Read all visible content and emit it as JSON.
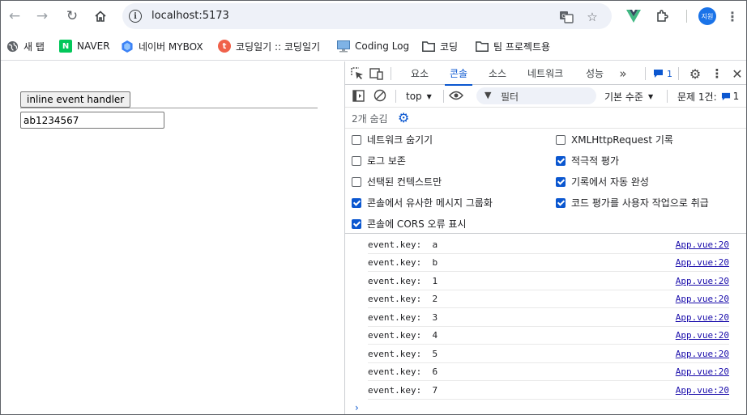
{
  "browser": {
    "url": "localhost:5173",
    "avatar_label": "지원",
    "bookmarks": [
      {
        "label": "새 탭",
        "icon": "globe-icon"
      },
      {
        "label": "NAVER",
        "icon": "naver-icon",
        "icon_text": "N"
      },
      {
        "label": "네이버 MYBOX",
        "icon": "mybox-icon"
      },
      {
        "label": "코딩일기 :: 코딩일기",
        "icon": "blog-icon"
      },
      {
        "label": "Coding Log",
        "icon": "monitor-icon"
      },
      {
        "label": "코딩",
        "icon": "folder-icon"
      },
      {
        "label": "팀 프로젝트용",
        "icon": "folder-icon"
      }
    ]
  },
  "page": {
    "button_label": "inline event handler",
    "input_value": "ab1234567"
  },
  "devtools": {
    "tabs": [
      "요소",
      "콘솔",
      "소스",
      "네트워크",
      "성능"
    ],
    "active_tab": "콘솔",
    "issues_badge": "1",
    "context": "top",
    "filter_placeholder": "필터",
    "level": "기본 수준",
    "issues_label": "문제 1건:",
    "issues_count": "1",
    "hidden_label": "2개 숨김",
    "settings": [
      {
        "label": "네트워크 숨기기",
        "checked": false
      },
      {
        "label": "XMLHttpRequest 기록",
        "checked": false
      },
      {
        "label": "로그 보존",
        "checked": false
      },
      {
        "label": "적극적 평가",
        "checked": true
      },
      {
        "label": "선택된 컨텍스트만",
        "checked": false
      },
      {
        "label": "기록에서 자동 완성",
        "checked": true
      },
      {
        "label": "콘솔에서 유사한 메시지 그룹화",
        "checked": true
      },
      {
        "label": "코드 평가를 사용자 작업으로 취급",
        "checked": true
      },
      {
        "label": "콘솔에 CORS 오류 표시",
        "checked": true
      }
    ],
    "logs": [
      {
        "text": "event.key:  a",
        "source": "App.vue:20"
      },
      {
        "text": "event.key:  b",
        "source": "App.vue:20"
      },
      {
        "text": "event.key:  1",
        "source": "App.vue:20"
      },
      {
        "text": "event.key:  2",
        "source": "App.vue:20"
      },
      {
        "text": "event.key:  3",
        "source": "App.vue:20"
      },
      {
        "text": "event.key:  4",
        "source": "App.vue:20"
      },
      {
        "text": "event.key:  5",
        "source": "App.vue:20"
      },
      {
        "text": "event.key:  6",
        "source": "App.vue:20"
      },
      {
        "text": "event.key:  7",
        "source": "App.vue:20"
      }
    ],
    "accent_color": "#0b57d0"
  }
}
